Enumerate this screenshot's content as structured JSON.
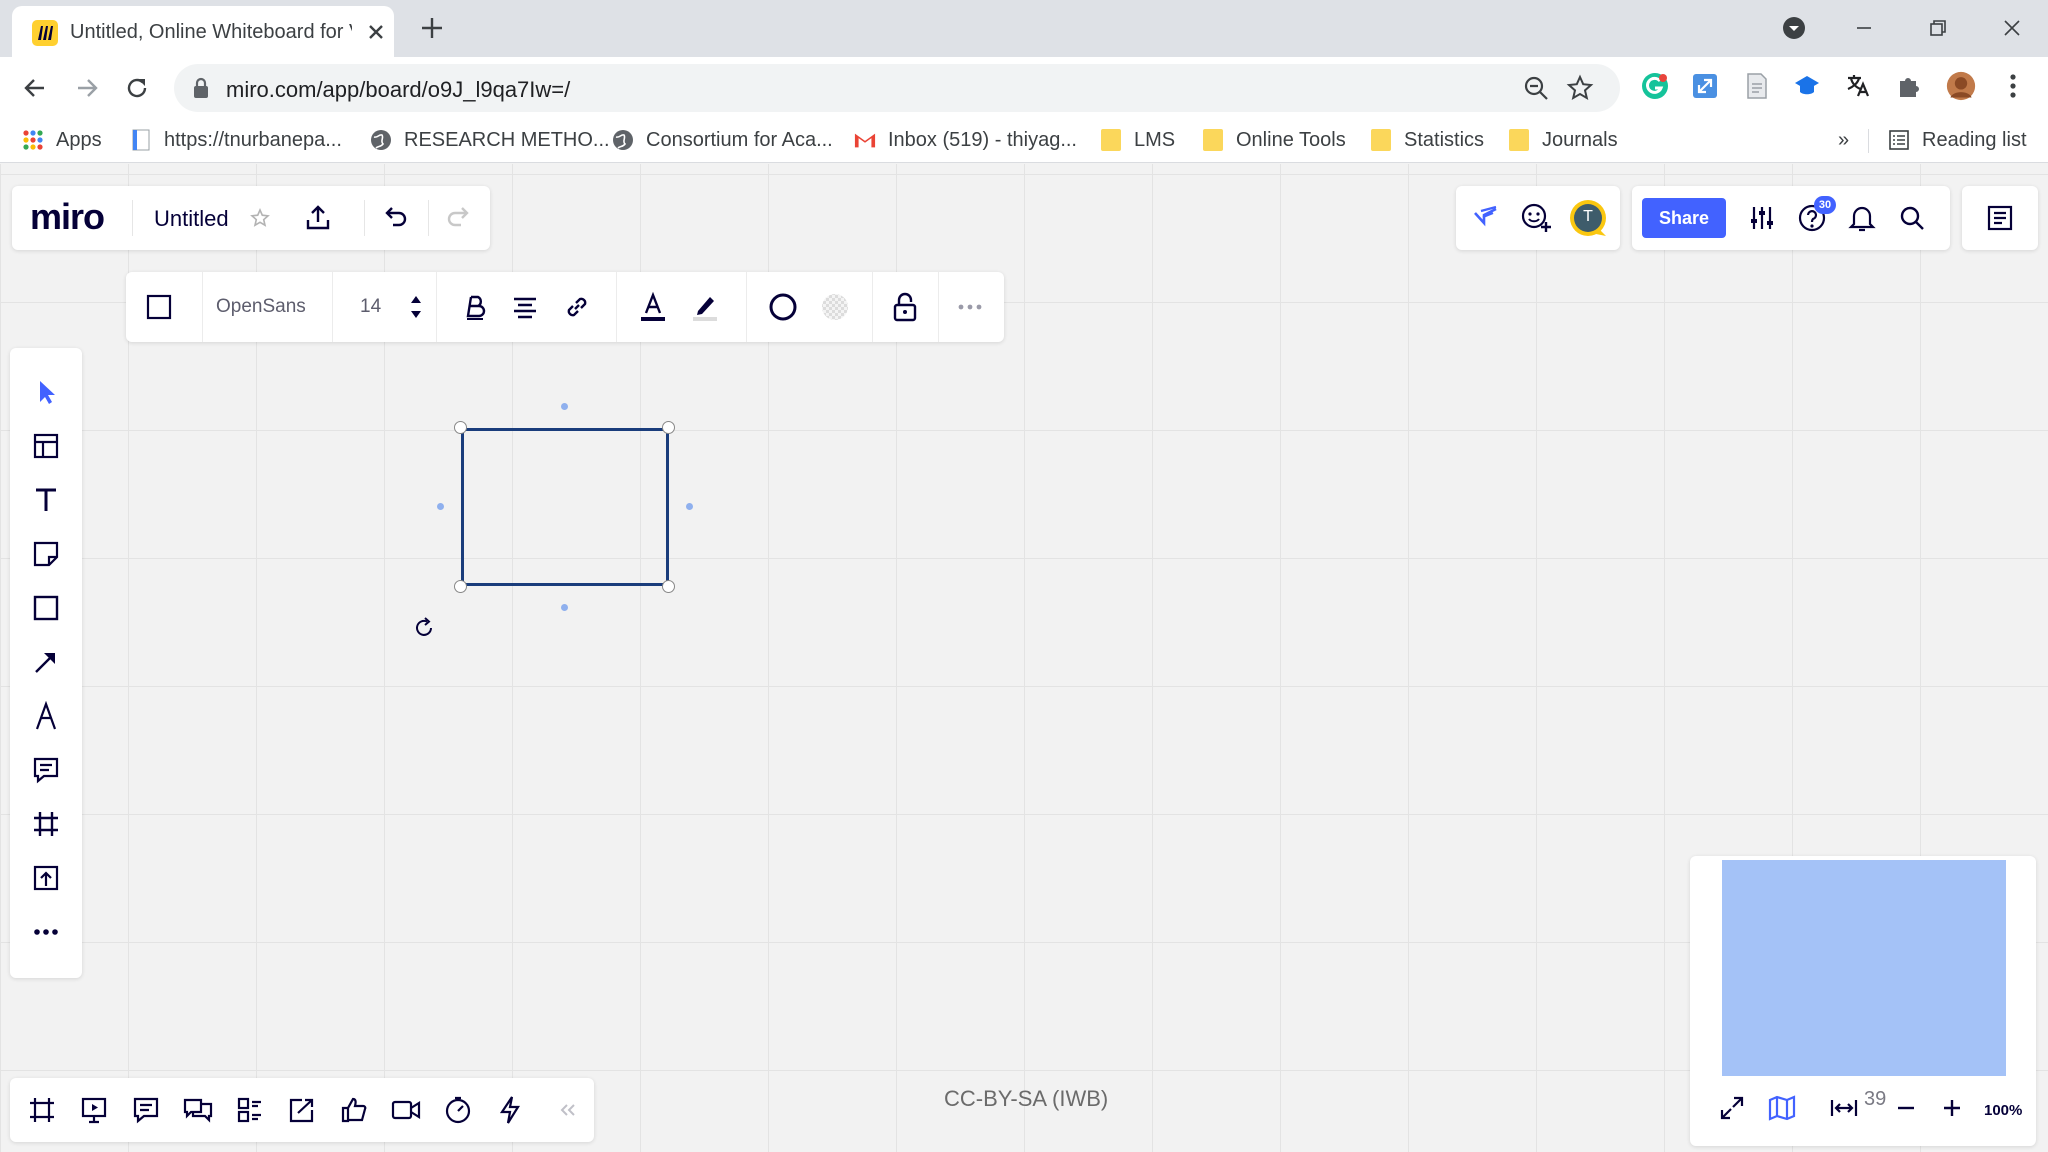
{
  "browser": {
    "tab_title": "Untitled, Online Whiteboard for V",
    "url": "miro.com/app/board/o9J_l9qa7Iw=/",
    "bookmarks": [
      {
        "label": "Apps",
        "icon": "apps-grid-icon"
      },
      {
        "label": "https://tnurbanepa...",
        "icon": "page-icon"
      },
      {
        "label": "RESEARCH METHO...",
        "icon": "globe-icon"
      },
      {
        "label": "Consortium for Aca...",
        "icon": "globe-icon"
      },
      {
        "label": "Inbox (519) - thiyag...",
        "icon": "gmail-icon"
      },
      {
        "label": "LMS",
        "icon": "folder-icon"
      },
      {
        "label": "Online Tools",
        "icon": "folder-icon"
      },
      {
        "label": "Statistics",
        "icon": "folder-icon"
      },
      {
        "label": "Journals",
        "icon": "folder-icon"
      }
    ],
    "more_bookmarks": "»",
    "reading_list": "Reading list"
  },
  "miro": {
    "logo": "miro",
    "board_name": "Untitled",
    "format_toolbar": {
      "font": "OpenSans",
      "font_size": "14"
    },
    "share_label": "Share",
    "help_badge": "30",
    "avatar_initial": "T",
    "minimap": {
      "number": "39",
      "zoom": "100%"
    }
  },
  "watermark": "CC-BY-SA (IWB)",
  "colors": {
    "accent": "#4262ff",
    "shape_border": "#1a3d7c",
    "minimap_view": "#a4c2f7",
    "miro_yellow": "#ffd02f"
  }
}
